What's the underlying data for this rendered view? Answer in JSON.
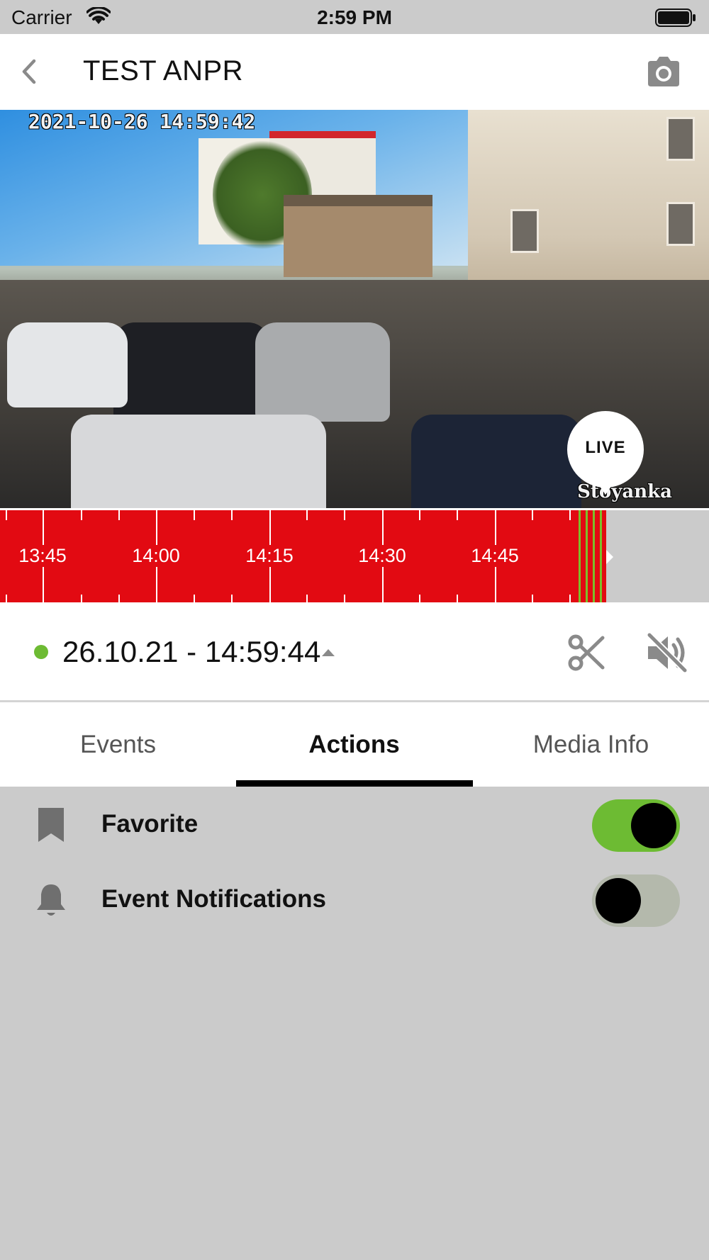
{
  "status_bar": {
    "carrier": "Carrier",
    "time": "2:59 PM",
    "icons": [
      "wifi-icon",
      "battery-icon"
    ]
  },
  "nav": {
    "title": "TEST ANPR",
    "back_icon": "chevron-left-icon",
    "snapshot_icon": "camera-icon"
  },
  "video": {
    "timestamp_overlay": "2021-10-26 14:59:42",
    "camera_name_overlay": "Stoyanka",
    "live_label": "LIVE"
  },
  "timeline": {
    "labels": [
      "13:45",
      "14:00",
      "14:15",
      "14:30",
      "14:45"
    ],
    "recorded_color": "#e20a12",
    "event_color": "#7cbf2a"
  },
  "controls": {
    "status_color": "#6dbb33",
    "datetime": "26.10.21 - 14:59:44",
    "clip_icon": "scissors-icon",
    "audio_icon": "volume-mute-icon"
  },
  "tabs": {
    "items": [
      "Events",
      "Actions",
      "Media Info"
    ],
    "active": "Actions"
  },
  "actions": [
    {
      "icon": "bookmark-icon",
      "label": "Favorite",
      "enabled": true
    },
    {
      "icon": "bell-icon",
      "label": "Event Notifications",
      "enabled": false
    }
  ],
  "colors": {
    "accent_green": "#6dbb33",
    "background": "#cbcbcb"
  }
}
